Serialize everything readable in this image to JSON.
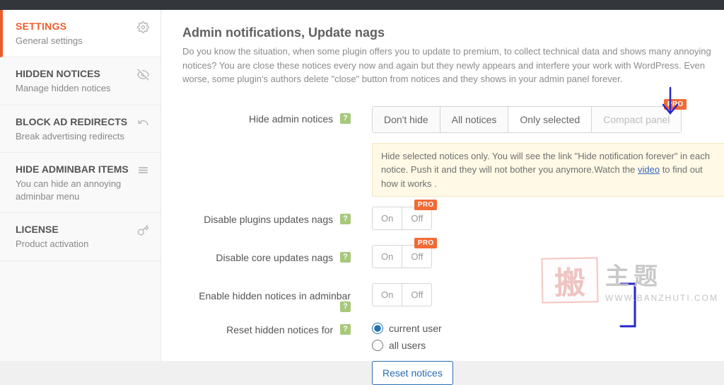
{
  "sidebar": [
    {
      "title": "SETTINGS",
      "sub": "General settings",
      "icon": "gear"
    },
    {
      "title": "HIDDEN NOTICES",
      "sub": "Manage hidden notices",
      "icon": "eye-off"
    },
    {
      "title": "BLOCK AD REDIRECTS",
      "sub": "Break advertising redirects",
      "icon": "undo"
    },
    {
      "title": "HIDE ADMINBAR ITEMS",
      "sub": "You can hide an annoying adminbar menu",
      "icon": "list"
    },
    {
      "title": "LICENSE",
      "sub": "Product activation",
      "icon": "key"
    }
  ],
  "header": {
    "title": "Admin notifications, Update nags",
    "intro": "Do you know the situation, when some plugin offers you to update to premium, to collect technical data and shows many annoying notices? You are close these notices every now and again but they newly appears and interfere your work with WordPress. Even worse, some plugin's authors delete \"close\" button from notices and they shows in your admin panel forever."
  },
  "rows": {
    "hide": {
      "label": "Hide admin notices",
      "opts": [
        "Don't hide",
        "All notices",
        "Only selected",
        "Compact panel"
      ],
      "selectedIndex": 2,
      "proOn": 3,
      "hint_pre": "Hide selected notices only. You will see the link \"Hide notification forever\" in each notice. Push it and they will not bother you anymore.Watch the ",
      "hint_link": "video",
      "hint_post": " to find out how it works ."
    },
    "disablePlugins": {
      "label": "Disable plugins updates nags",
      "on": "On",
      "off": "Off",
      "pro": "PRO"
    },
    "disableCore": {
      "label": "Disable core updates nags",
      "on": "On",
      "off": "Off",
      "pro": "PRO"
    },
    "enableHidden": {
      "label": "Enable hidden notices in adminbar",
      "on": "On",
      "off": "Off"
    },
    "reset": {
      "label": "Reset hidden notices for",
      "radios": [
        "current user",
        "all users"
      ],
      "selectedIndex": 0,
      "button": "Reset notices"
    }
  },
  "badges": {
    "pro": "PRO",
    "help": "?"
  },
  "watermark": {
    "seal": "搬",
    "text": "主题",
    "url": "WWW.BANZHUTI.COM"
  }
}
